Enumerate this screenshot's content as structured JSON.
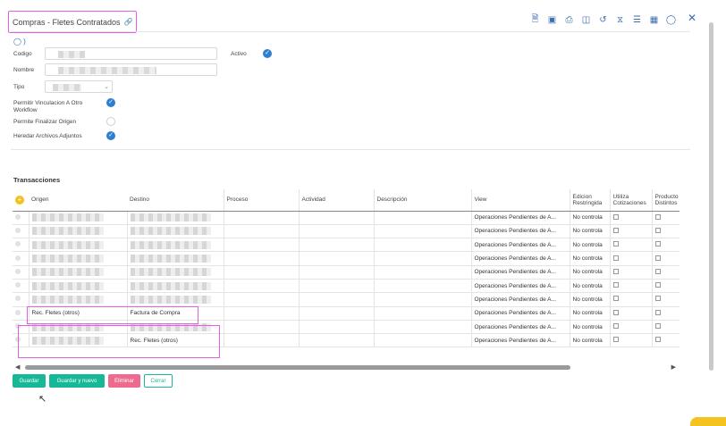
{
  "header": {
    "title": "Compras - Fletes Contratados",
    "toolbar_icons": [
      "export-icon",
      "save-icon",
      "print-icon",
      "delete-icon",
      "history-icon",
      "attach-icon",
      "checklist-icon",
      "document-icon",
      "comment-icon"
    ]
  },
  "form": {
    "codigo_label": "Codigo",
    "nombre_label": "Nombre",
    "tipo_label": "Tipo",
    "activo_label": "Activo",
    "permitir_label": "Permitir Vinculacion A Otro Workflow",
    "finalizar_label": "Permite Finalizar Origen",
    "heredar_label": "Heredar Archivos Adjuntos"
  },
  "transacciones": {
    "title": "Transacciones",
    "columns": [
      "Origen",
      "Destino",
      "Proceso",
      "Actividad",
      "Descripción",
      "View",
      "Edicion Restringida",
      "Utiliza Cotizaciones",
      "Producto Distintos"
    ],
    "rows": [
      {
        "origen": "",
        "destino": "",
        "view": "Operaciones Pendientes de A...",
        "edicion": "No controla"
      },
      {
        "origen": "",
        "destino": "",
        "view": "Operaciones Pendientes de A...",
        "edicion": "No controla"
      },
      {
        "origen": "",
        "destino": "",
        "view": "Operaciones Pendientes de A...",
        "edicion": "No controla"
      },
      {
        "origen": "",
        "destino": "",
        "view": "Operaciones Pendientes de A...",
        "edicion": "No controla"
      },
      {
        "origen": "",
        "destino": "",
        "view": "Operaciones Pendientes de A...",
        "edicion": "No controla"
      },
      {
        "origen": "",
        "destino": "",
        "view": "Operaciones Pendientes de A...",
        "edicion": "No controla"
      },
      {
        "origen": "",
        "destino": "",
        "view": "Operaciones Pendientes de A...",
        "edicion": "No controla"
      },
      {
        "origen": "Rec. Fletes (otros)",
        "destino": "Factura de Compra",
        "view": "Operaciones Pendientes de A...",
        "edicion": "No controla"
      },
      {
        "origen": "",
        "destino": "",
        "view": "Operaciones Pendientes de A...",
        "edicion": "No controla"
      },
      {
        "origen": "",
        "destino": "Rec. Fletes (otros)",
        "view": "Operaciones Pendientes de A...",
        "edicion": "No controla"
      }
    ]
  },
  "footer": {
    "guardar": "Guardar",
    "guardar_nuevo": "Guardar y nuevo",
    "eliminar": "Eliminar",
    "cerrar": "Cerrar"
  }
}
